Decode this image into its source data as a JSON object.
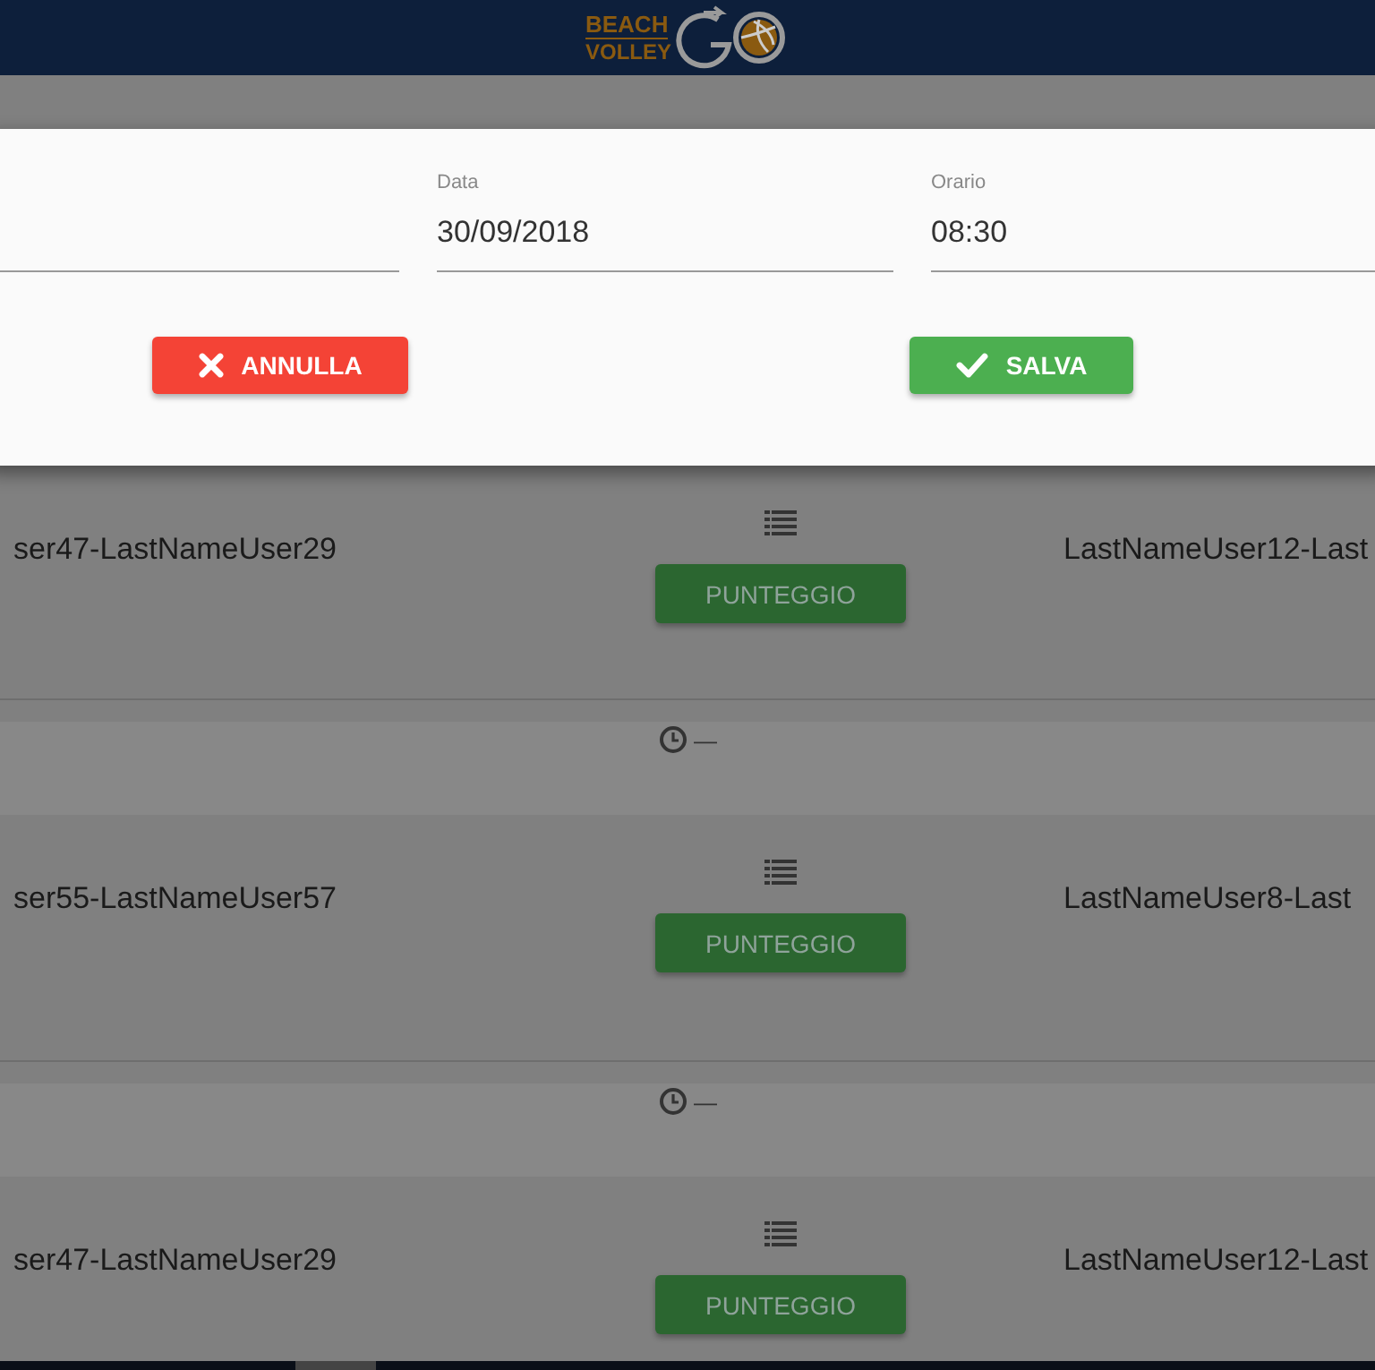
{
  "header": {
    "logo_line_1": "BEACH",
    "logo_line_2": "VOLLEY"
  },
  "dialog": {
    "fields": [
      {
        "label": "Data",
        "value": "30/09/2018"
      },
      {
        "label": "Orario",
        "value": "08:30"
      }
    ],
    "buttons": [
      {
        "kind": "cancel",
        "label": "ANNULLA"
      },
      {
        "kind": "save",
        "label": "SALVA"
      }
    ]
  },
  "rows": [
    {
      "kind": "match",
      "team_1": "ser47-LastNameUser29",
      "team_2": "LastNameUser12-Last",
      "button": "PUNTEGGIO"
    },
    {
      "kind": "time",
      "time": "—"
    },
    {
      "kind": "match",
      "team_1": "ser55-LastNameUser57",
      "team_2": "LastNameUser8-Last",
      "button": "PUNTEGGIO"
    },
    {
      "kind": "time",
      "time": "—"
    },
    {
      "kind": "match",
      "team_1": "ser47-LastNameUser29",
      "team_2": "LastNameUser12-Last",
      "button": "PUNTEGGIO"
    }
  ]
}
